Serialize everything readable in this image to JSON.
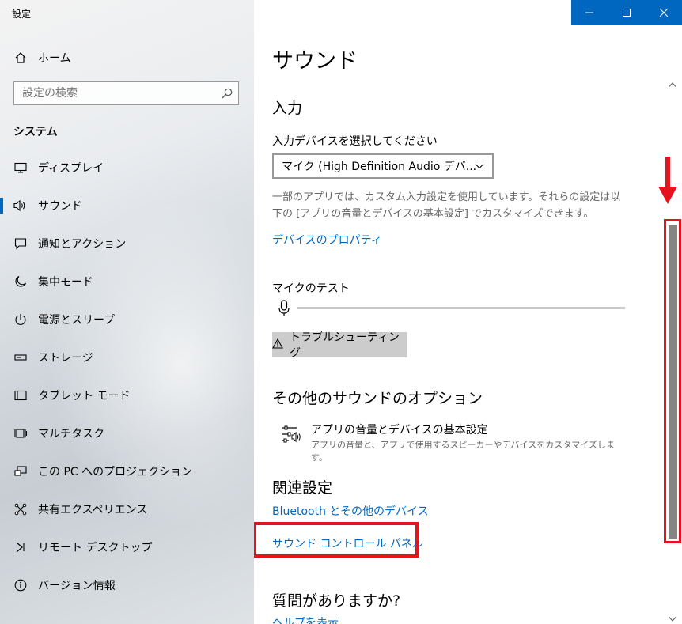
{
  "window": {
    "title": "設定"
  },
  "sidebar": {
    "home": "ホーム",
    "search_placeholder": "設定の検索",
    "section": "システム",
    "items": [
      {
        "label": "ディスプレイ",
        "icon": "monitor-icon"
      },
      {
        "label": "サウンド",
        "icon": "speaker-icon",
        "active": true
      },
      {
        "label": "通知とアクション",
        "icon": "notification-icon"
      },
      {
        "label": "集中モード",
        "icon": "moon-icon"
      },
      {
        "label": "電源とスリープ",
        "icon": "power-icon"
      },
      {
        "label": "ストレージ",
        "icon": "storage-icon"
      },
      {
        "label": "タブレット モード",
        "icon": "tablet-icon"
      },
      {
        "label": "マルチタスク",
        "icon": "multitask-icon"
      },
      {
        "label": "この PC へのプロジェクション",
        "icon": "projection-icon"
      },
      {
        "label": "共有エクスペリエンス",
        "icon": "share-icon"
      },
      {
        "label": "リモート デスクトップ",
        "icon": "remote-desktop-icon"
      },
      {
        "label": "バージョン情報",
        "icon": "info-icon"
      }
    ]
  },
  "main": {
    "title": "サウンド",
    "input": {
      "heading": "入力",
      "select_label": "入力デバイスを選択してください",
      "selected_device": "マイク (High Definition Audio デバ...",
      "description": "一部のアプリでは、カスタム入力設定を使用しています。それらの設定は以下の [アプリの音量とデバイスの基本設定] でカスタマイズできます。",
      "device_properties_link": "デバイスのプロパティ",
      "mic_test_label": "マイクのテスト",
      "mic_level": 0,
      "troubleshoot_button": "トラブルシューティング"
    },
    "other_options": {
      "heading": "その他のサウンドのオプション",
      "app_volume_title": "アプリの音量とデバイスの基本設定",
      "app_volume_desc": "アプリの音量と、アプリで使用するスピーカーやデバイスをカスタマイズします。"
    },
    "related": {
      "heading": "関連設定",
      "bluetooth_link": "Bluetooth とその他のデバイス",
      "sound_control_panel_link": "サウンド コントロール パネル"
    },
    "help": {
      "heading": "質問がありますか?",
      "help_link": "ヘルプを表示"
    }
  },
  "colors": {
    "accent": "#0067c0",
    "annotation": "#e5131d",
    "scroll_thumb": "#858585"
  }
}
